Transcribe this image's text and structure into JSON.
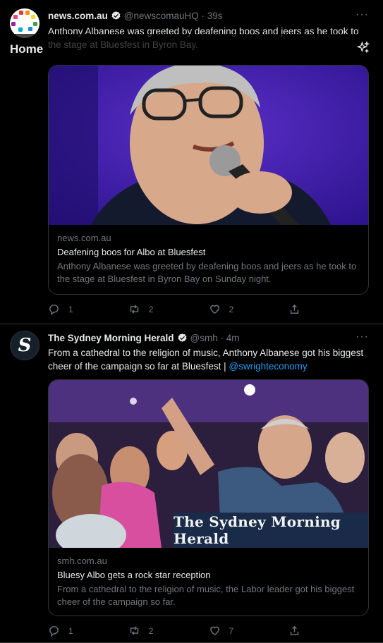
{
  "header": {
    "title": "Home",
    "sparkle_icon": "sparkle-icon"
  },
  "tweets": [
    {
      "name": "news.com.au",
      "handle": "@newscomauHQ · 39s",
      "text": "Anthony Albanese was greeted by deafening boos and jeers as he took to the stage at Bluesfest in Byron Bay.",
      "card": {
        "domain": "news.com.au",
        "title": "Deafening boos for Albo at Bluesfest",
        "description": "Anthony Albanese was greeted by deafening boos and jeers as he took to the stage at Bluesfest in Byron Bay on Sunday night."
      },
      "replies": "1",
      "retweets": "2",
      "likes": "2"
    },
    {
      "name": "The Sydney Morning Herald",
      "handle": "@smh · 4m",
      "text": "From a cathedral to the religion of music, Anthony Albanese got his biggest cheer of the campaign so far at Bluesfest | ",
      "mention": "@swrighteconomy",
      "card": {
        "domain": "smh.com.au",
        "title": "Bluesy Albo gets a rock star reception",
        "description": "From a cathedral to the religion of music, the Labor leader got his biggest cheer of the campaign so far.",
        "masthead": "The Sydney Morning Herald"
      },
      "replies": "1",
      "retweets": "2",
      "likes": "7"
    }
  ],
  "colors": {
    "accent": "#1d9bf0",
    "muted": "#71767b",
    "border": "#2f3336"
  }
}
